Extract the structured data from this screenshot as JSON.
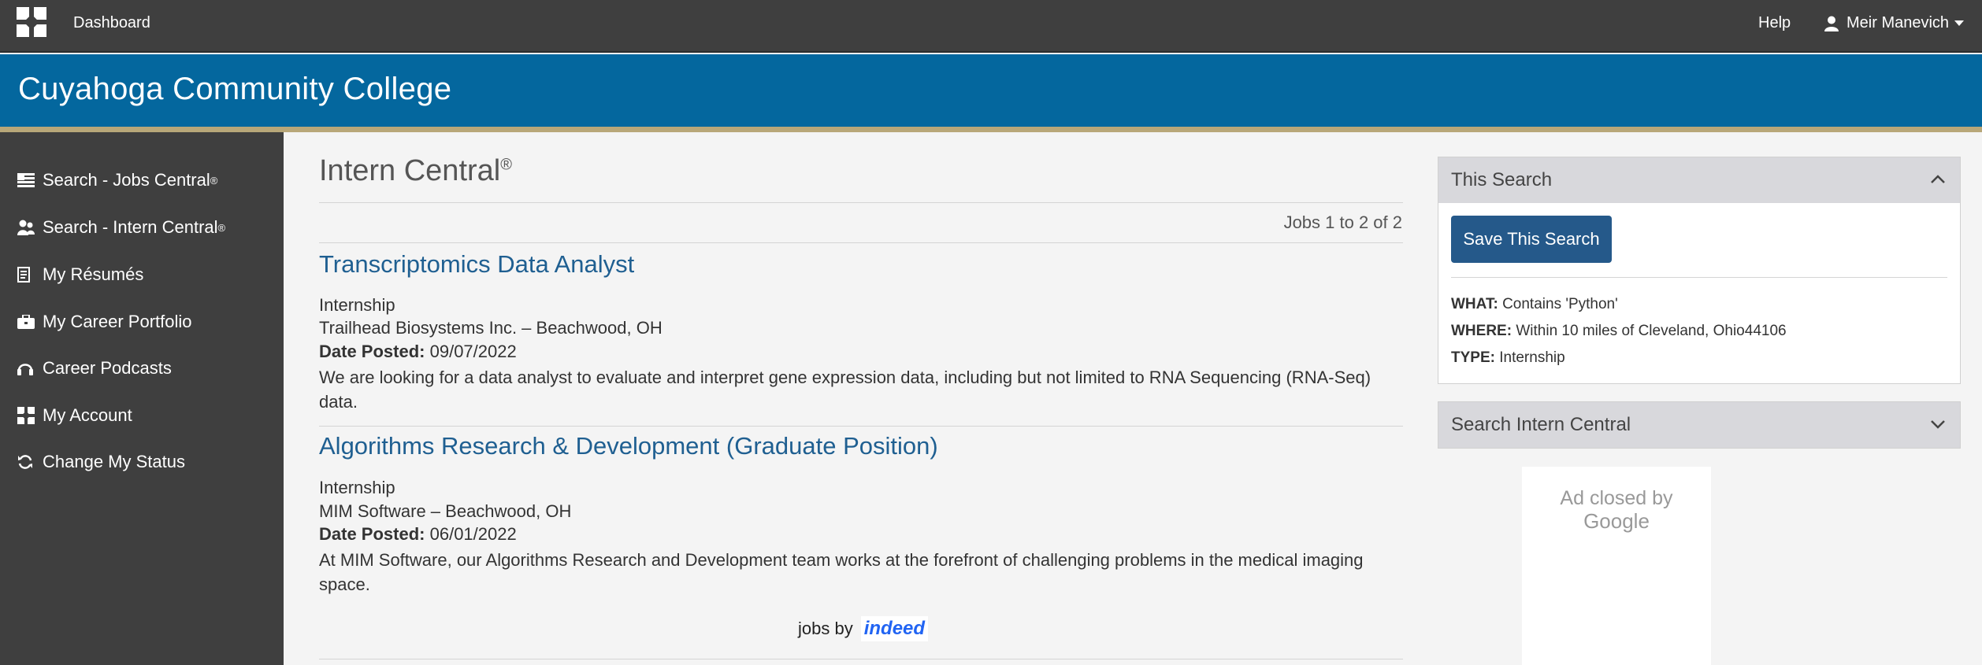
{
  "topbar": {
    "dashboard_label": "Dashboard",
    "help_label": "Help",
    "user_name": "Meir Manevich"
  },
  "banner": {
    "title": "Cuyahoga Community College"
  },
  "sidebar": {
    "items": [
      {
        "label": "Search - Jobs Central",
        "sup": "®",
        "icon": "flag-icon"
      },
      {
        "label": "Search - Intern Central",
        "sup": "®",
        "icon": "users-icon"
      },
      {
        "label": "My Résumés",
        "sup": "",
        "icon": "document-icon"
      },
      {
        "label": "My Career Portfolio",
        "sup": "",
        "icon": "briefcase-icon"
      },
      {
        "label": "Career Podcasts",
        "sup": "",
        "icon": "headphones-icon"
      },
      {
        "label": "My Account",
        "sup": "",
        "icon": "account-icon"
      },
      {
        "label": "Change My Status",
        "sup": "",
        "icon": "refresh-icon"
      }
    ]
  },
  "main": {
    "title": "Intern Central",
    "title_sup": "®",
    "results_count": "Jobs 1 to 2 of 2",
    "jobs": [
      {
        "title": "Transcriptomics Data Analyst",
        "type": "Internship",
        "company_location": "Trailhead Biosystems Inc. – Beachwood, OH",
        "date_label": "Date Posted:",
        "date": "09/07/2022",
        "description": "We are looking for a data analyst to evaluate and interpret gene expression data, including but not limited to RNA Sequencing (RNA-Seq) data."
      },
      {
        "title": "Algorithms Research & Development (Graduate Position)",
        "type": "Internship",
        "company_location": "MIM Software – Beachwood, OH",
        "date_label": "Date Posted:",
        "date": "06/01/2022",
        "description": "At MIM Software, our Algorithms Research and Development team works at the forefront of challenging problems in the medical imaging space."
      }
    ],
    "jobs_by_label": "jobs by",
    "indeed_label": "indeed"
  },
  "this_search": {
    "header": "This Search",
    "save_button": "Save This Search",
    "what_label": "WHAT:",
    "what_value": "Contains 'Python'",
    "where_label": "WHERE:",
    "where_value": "Within 10 miles of Cleveland, Ohio44106",
    "type_label": "TYPE:",
    "type_value": "Internship"
  },
  "search_intern": {
    "header": "Search Intern Central"
  },
  "ad": {
    "line1": "Ad closed by",
    "line2": "Google"
  },
  "colors": {
    "topbar": "#3f3f3f",
    "banner": "#04679e",
    "accent_stripe": "#b8a779",
    "link": "#1f5f91",
    "button": "#25598a"
  }
}
